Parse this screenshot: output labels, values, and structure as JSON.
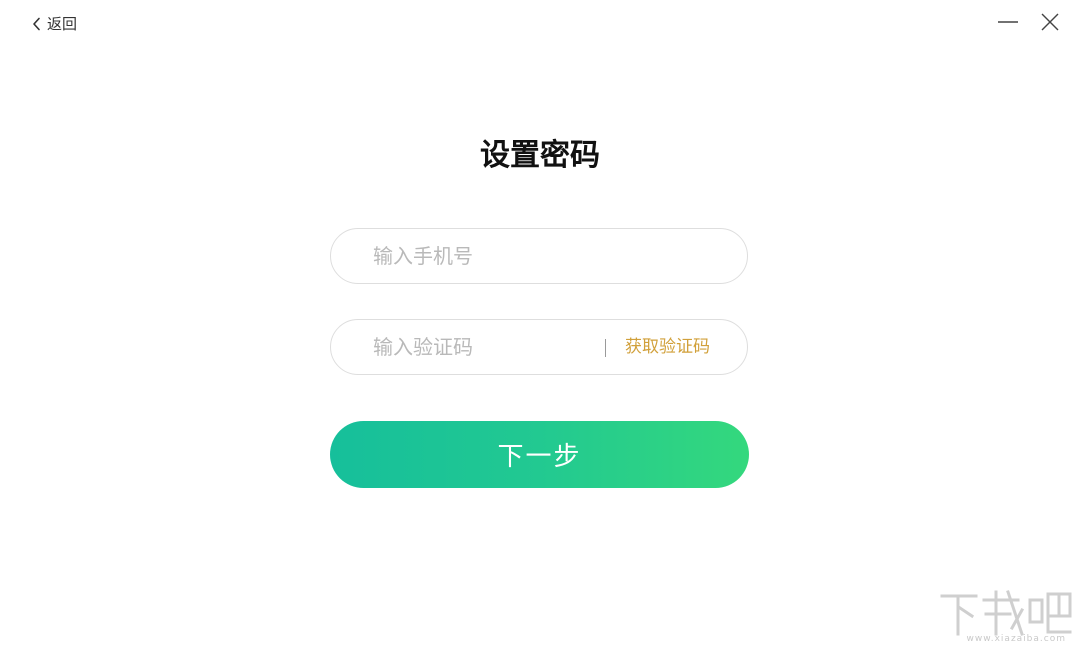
{
  "nav": {
    "back_label": "返回"
  },
  "window": {
    "minimize_icon": "minimize-icon",
    "close_icon": "close-icon"
  },
  "page": {
    "title": "设置密码"
  },
  "form": {
    "phone_placeholder": "输入手机号",
    "phone_value": "",
    "code_placeholder": "输入验证码",
    "code_value": "",
    "get_code_label": "获取验证码",
    "next_label": "下一步"
  },
  "watermark": {
    "logo": "下载吧",
    "url": "www.xiazaiba.com"
  },
  "colors": {
    "accent_start": "#16bf9b",
    "accent_end": "#34d87d",
    "link_gold": "#d1a03a",
    "placeholder": "#b9b9b9"
  }
}
